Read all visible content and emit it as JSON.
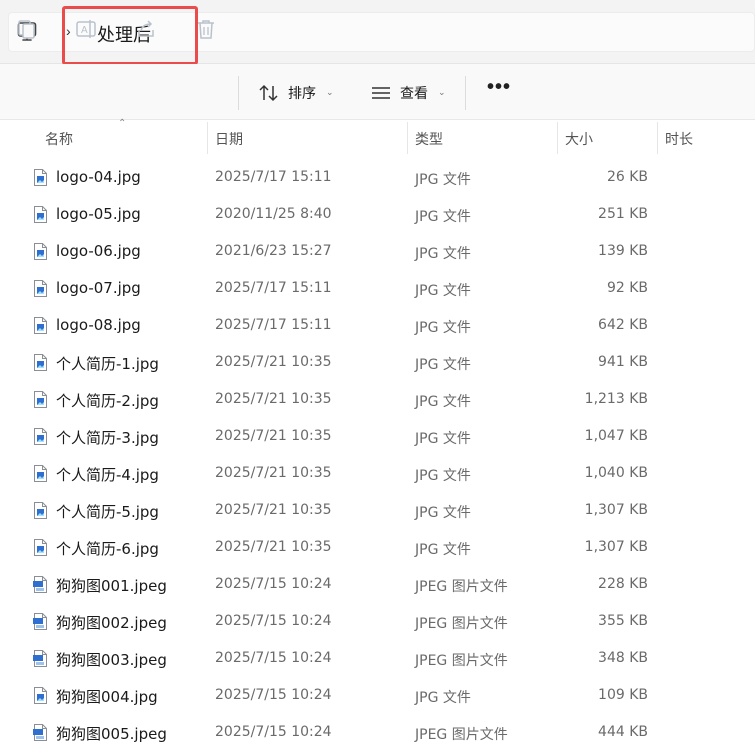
{
  "address": {
    "breadcrumb": "处理后",
    "separator": "›"
  },
  "toolbar": {
    "sort_label": "排序",
    "view_label": "查看",
    "more_label": "•••",
    "icons": [
      "copy-icon",
      "rename-icon",
      "share-icon",
      "delete-icon",
      "sort-icon",
      "view-icon",
      "more-icon"
    ]
  },
  "columns": {
    "name": "名称",
    "date": "日期",
    "type": "类型",
    "size": "大小",
    "duration": "时长"
  },
  "files": [
    {
      "name": "logo-04.jpg",
      "date": "2025/7/17 15:11",
      "type": "JPG 文件",
      "size": "26 KB",
      "icon": "jpg"
    },
    {
      "name": "logo-05.jpg",
      "date": "2020/11/25 8:40",
      "type": "JPG 文件",
      "size": "251 KB",
      "icon": "jpg"
    },
    {
      "name": "logo-06.jpg",
      "date": "2021/6/23 15:27",
      "type": "JPG 文件",
      "size": "139 KB",
      "icon": "jpg"
    },
    {
      "name": "logo-07.jpg",
      "date": "2025/7/17 15:11",
      "type": "JPG 文件",
      "size": "92 KB",
      "icon": "jpg"
    },
    {
      "name": "logo-08.jpg",
      "date": "2025/7/17 15:11",
      "type": "JPG 文件",
      "size": "642 KB",
      "icon": "jpg"
    },
    {
      "name": "个人简历-1.jpg",
      "date": "2025/7/21 10:35",
      "type": "JPG 文件",
      "size": "941 KB",
      "icon": "jpg"
    },
    {
      "name": "个人简历-2.jpg",
      "date": "2025/7/21 10:35",
      "type": "JPG 文件",
      "size": "1,213 KB",
      "icon": "jpg"
    },
    {
      "name": "个人简历-3.jpg",
      "date": "2025/7/21 10:35",
      "type": "JPG 文件",
      "size": "1,047 KB",
      "icon": "jpg"
    },
    {
      "name": "个人简历-4.jpg",
      "date": "2025/7/21 10:35",
      "type": "JPG 文件",
      "size": "1,040 KB",
      "icon": "jpg"
    },
    {
      "name": "个人简历-5.jpg",
      "date": "2025/7/21 10:35",
      "type": "JPG 文件",
      "size": "1,307 KB",
      "icon": "jpg"
    },
    {
      "name": "个人简历-6.jpg",
      "date": "2025/7/21 10:35",
      "type": "JPG 文件",
      "size": "1,307 KB",
      "icon": "jpg"
    },
    {
      "name": "狗狗图001.jpeg",
      "date": "2025/7/15 10:24",
      "type": "JPEG 图片文件",
      "size": "228 KB",
      "icon": "jpeg"
    },
    {
      "name": "狗狗图002.jpeg",
      "date": "2025/7/15 10:24",
      "type": "JPEG 图片文件",
      "size": "355 KB",
      "icon": "jpeg"
    },
    {
      "name": "狗狗图003.jpeg",
      "date": "2025/7/15 10:24",
      "type": "JPEG 图片文件",
      "size": "348 KB",
      "icon": "jpeg"
    },
    {
      "name": "狗狗图004.jpg",
      "date": "2025/7/15 10:24",
      "type": "JPG 文件",
      "size": "109 KB",
      "icon": "jpg"
    },
    {
      "name": "狗狗图005.jpeg",
      "date": "2025/7/15 10:24",
      "type": "JPEG 图片文件",
      "size": "444 KB",
      "icon": "jpeg"
    }
  ],
  "colors": {
    "highlight": "#ea4b4b",
    "icon_blue": "#2f6fd0"
  }
}
